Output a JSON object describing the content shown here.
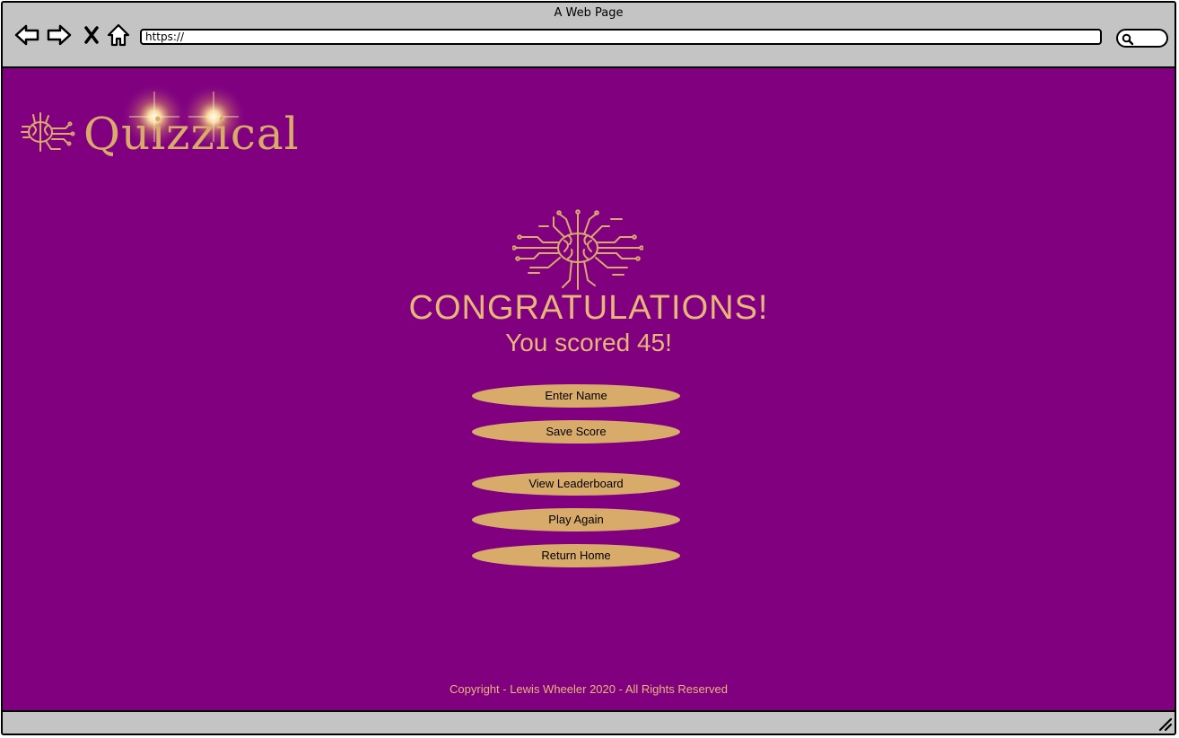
{
  "browser": {
    "window_title": "A Web Page",
    "url": "https://"
  },
  "logo": {
    "text": "Quizzical"
  },
  "result": {
    "heading": "CONGRATULATIONS!",
    "score_text": "You scored 45!"
  },
  "buttons": {
    "enter_name": "Enter Name",
    "save_score": "Save Score",
    "view_leaderboard": "View Leaderboard",
    "play_again": "Play Again",
    "return_home": "Return Home"
  },
  "footer": {
    "copyright": "Copyright - Lewis Wheeler 2020 - All Rights Reserved"
  },
  "colors": {
    "page_background": "#800080",
    "accent_gold": "#d9ab6b",
    "browser_chrome": "#c4c4c4"
  },
  "icons": {
    "back": "back-arrow-icon",
    "forward": "forward-arrow-icon",
    "stop": "close-icon",
    "home": "home-icon",
    "search": "search-icon",
    "brain": "circuit-brain-icon"
  }
}
